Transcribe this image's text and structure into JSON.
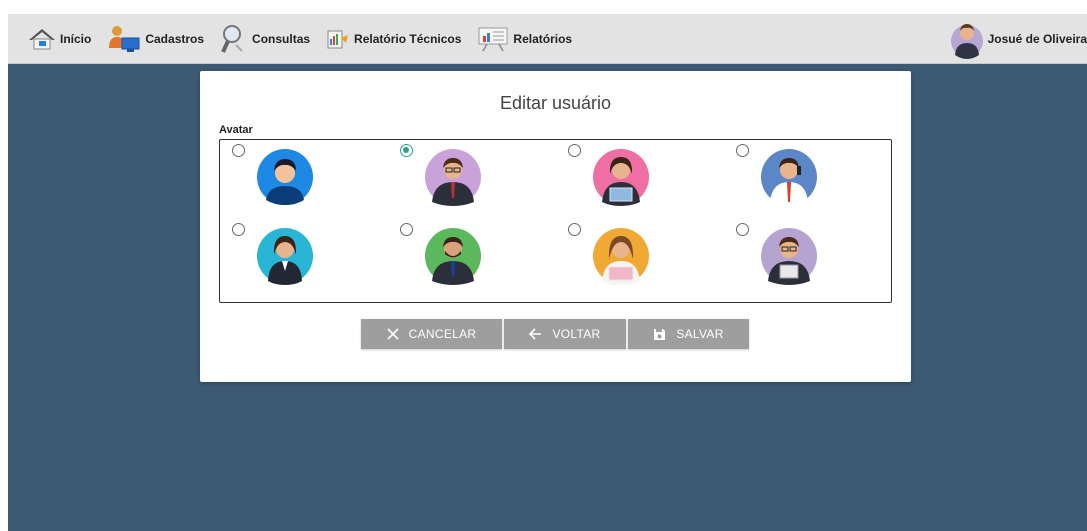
{
  "nav": {
    "items": [
      {
        "label": "Início",
        "icon": "home-icon"
      },
      {
        "label": "Cadastros",
        "icon": "people-icon"
      },
      {
        "label": "Consultas",
        "icon": "magnifier-icon"
      },
      {
        "label": "Relatório Técnicos",
        "icon": "report-icon"
      },
      {
        "label": "Relatórios",
        "icon": "presentation-chart-icon"
      }
    ],
    "user": {
      "name": "Josué de Oliveira",
      "icon": "user-avatar-icon"
    }
  },
  "dialog": {
    "title": "Editar usuário",
    "avatar_label": "Avatar",
    "selected_index": 1,
    "avatars": [
      {
        "bg": "#1e88e5",
        "kind": "boy"
      },
      {
        "bg": "#c8a2d9",
        "kind": "man-glasses-suit"
      },
      {
        "bg": "#ef6fa5",
        "kind": "woman-laptop"
      },
      {
        "bg": "#5b86c7",
        "kind": "man-phone"
      },
      {
        "bg": "#29b6d6",
        "kind": "woman-suit"
      },
      {
        "bg": "#5cb85c",
        "kind": "man-beard-suit"
      },
      {
        "bg": "#f0a935",
        "kind": "woman-laptop-pink"
      },
      {
        "bg": "#b7a3d0",
        "kind": "man-glasses-tablet"
      }
    ],
    "buttons": {
      "cancel": "CANCELAR",
      "back": "VOLTAR",
      "save": "SALVAR"
    }
  },
  "colors": {
    "topbar": "#e3e3e3",
    "background": "#3d5a73",
    "button": "#9e9e9e",
    "radio_selected": "#2aa58b"
  }
}
